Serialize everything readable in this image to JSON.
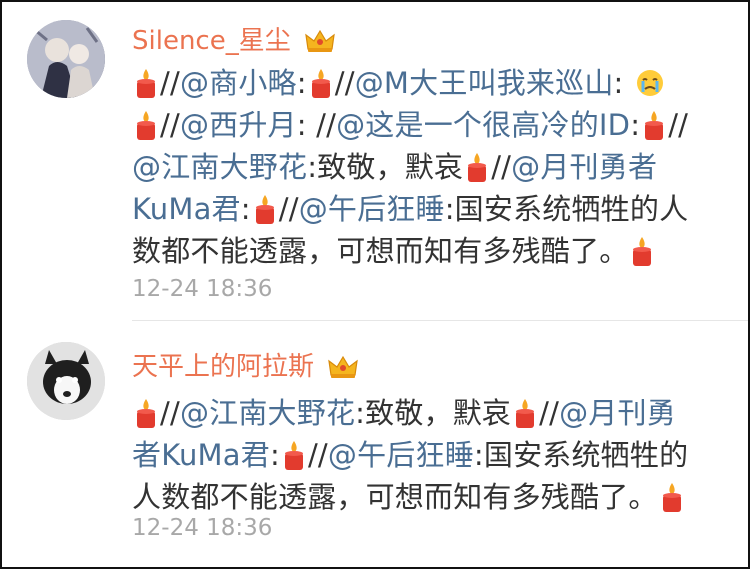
{
  "comments": [
    {
      "username": "Silence_星尘",
      "timestamp": "12-24 18:36",
      "badge_icon": "vip-crown-icon",
      "lines": [
        {
          "mention1": "@商小略",
          "colon1": ":",
          "mention2": "@M大王叫我来巡山",
          "colon2": ": "
        },
        {
          "mention1": "@西升月",
          "colon1": ": ",
          "mention2": "@这是一个很高冷的ID",
          "colon2": ":"
        },
        {
          "mention1": "@江南大野花",
          "text1": ":致敬，默哀",
          "mention2": "@月刊勇者"
        },
        {
          "mention1": "KuMa君",
          "colon1": ":",
          "mention2": "@午后狂睡",
          "text2": ":国安系统牺牲的人"
        },
        {
          "text1": "数都不能透露，可想而知有多残酷了。"
        }
      ]
    },
    {
      "username": "天平上的阿拉斯",
      "timestamp": "12-24 18:36",
      "badge_icon": "vip-crown-icon",
      "lines": [
        {
          "mention1": "@江南大野花",
          "text1": ":致敬，默哀",
          "mention2": "@月刊勇"
        },
        {
          "mention1": "者KuMa君",
          "colon1": ":",
          "mention2": "@午后狂睡",
          "text2": ":国安系统牺牲的"
        },
        {
          "text1": "人数都不能透露，可想而知有多残酷了。"
        }
      ]
    }
  ],
  "colors": {
    "username": "#eb7350",
    "mention": "#4a6e93",
    "text": "#333333",
    "timestamp": "#a8a8a8"
  },
  "separator": "//"
}
